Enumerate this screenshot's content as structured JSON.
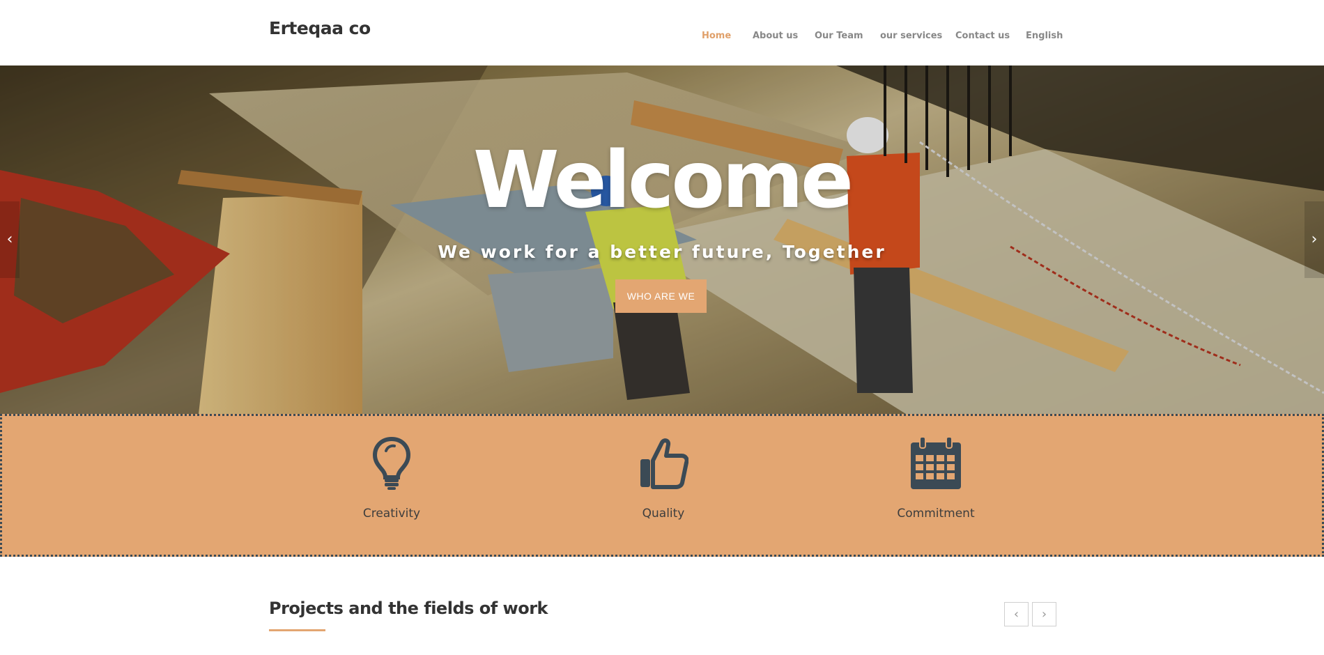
{
  "header": {
    "logo": "Erteqaa co",
    "nav": [
      {
        "label": "Home",
        "active": true
      },
      {
        "label": "About us",
        "active": false
      },
      {
        "label": "Our Team",
        "active": false
      },
      {
        "label": "our services",
        "active": false
      },
      {
        "label": "Contact us",
        "active": false
      },
      {
        "label": "English",
        "active": false
      }
    ]
  },
  "hero": {
    "title": "Welcome",
    "subtitle": "We work for a better future, Together",
    "button_label": "WHO ARE WE",
    "prev_icon": "chevron-left-icon",
    "next_icon": "chevron-right-icon"
  },
  "features": {
    "items": [
      {
        "label": "Creativity",
        "icon": "lightbulb-icon"
      },
      {
        "label": "Quality",
        "icon": "thumbs-up-icon"
      },
      {
        "label": "Commitment",
        "icon": "calendar-icon"
      }
    ]
  },
  "projects": {
    "title": "Projects and the fields of work",
    "prev_icon": "chevron-left-icon",
    "next_icon": "chevron-right-icon"
  },
  "colors": {
    "accent": "#e3a672",
    "nav_active": "#e0a06a",
    "icon_dark": "#3b4a55",
    "text_dark": "#333333"
  }
}
